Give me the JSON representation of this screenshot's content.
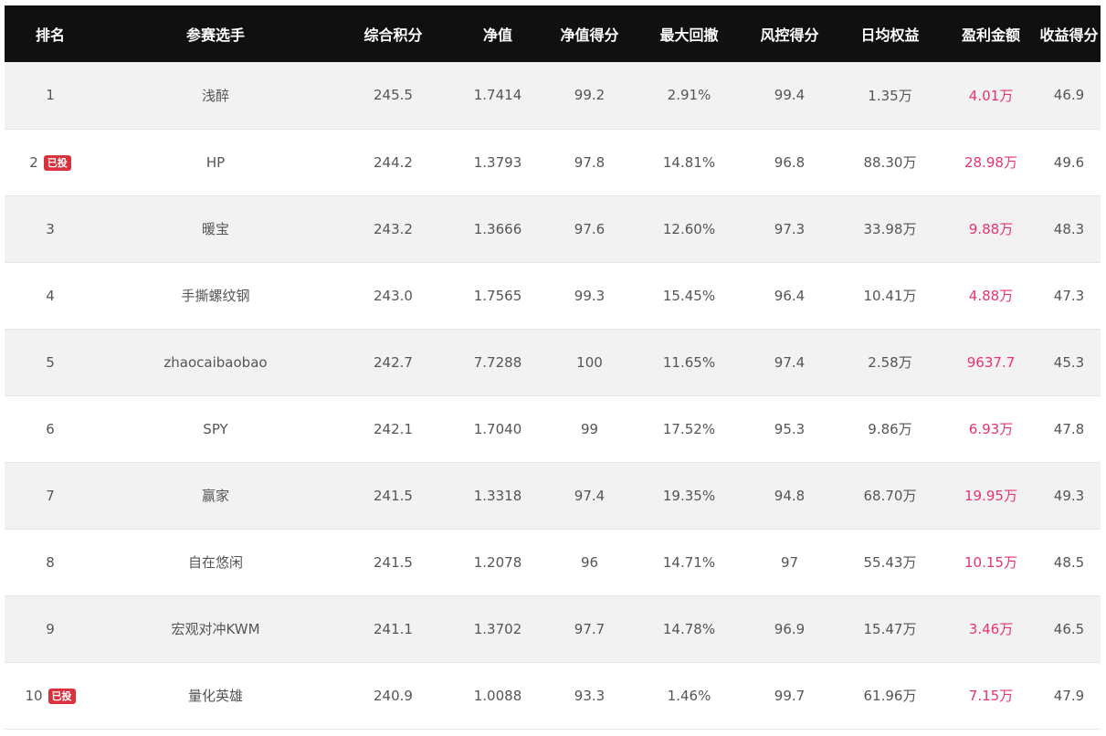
{
  "table": {
    "headers": [
      "排名",
      "参赛选手",
      "综合积分",
      "净值",
      "净值得分",
      "最大回撤",
      "风控得分",
      "日均权益",
      "盈利金额",
      "收益得分"
    ],
    "rows": [
      {
        "rank": "1",
        "badge": "",
        "player": "浅醉",
        "total": "245.5",
        "nav": "1.7414",
        "nav_score": "99.2",
        "max_dd": "2.91%",
        "risk_score": "99.4",
        "avg_equity": "1.35万",
        "profit": "4.01万",
        "return_score": "46.9"
      },
      {
        "rank": "2",
        "badge": "已投",
        "player": "HP",
        "total": "244.2",
        "nav": "1.3793",
        "nav_score": "97.8",
        "max_dd": "14.81%",
        "risk_score": "96.8",
        "avg_equity": "88.30万",
        "profit": "28.98万",
        "return_score": "49.6"
      },
      {
        "rank": "3",
        "badge": "",
        "player": "暖宝",
        "total": "243.2",
        "nav": "1.3666",
        "nav_score": "97.6",
        "max_dd": "12.60%",
        "risk_score": "97.3",
        "avg_equity": "33.98万",
        "profit": "9.88万",
        "return_score": "48.3"
      },
      {
        "rank": "4",
        "badge": "",
        "player": "手撕螺纹钢",
        "total": "243.0",
        "nav": "1.7565",
        "nav_score": "99.3",
        "max_dd": "15.45%",
        "risk_score": "96.4",
        "avg_equity": "10.41万",
        "profit": "4.88万",
        "return_score": "47.3"
      },
      {
        "rank": "5",
        "badge": "",
        "player": "zhaocaibaobao",
        "total": "242.7",
        "nav": "7.7288",
        "nav_score": "100",
        "max_dd": "11.65%",
        "risk_score": "97.4",
        "avg_equity": "2.58万",
        "profit": "9637.7",
        "return_score": "45.3"
      },
      {
        "rank": "6",
        "badge": "",
        "player": "SPY",
        "total": "242.1",
        "nav": "1.7040",
        "nav_score": "99",
        "max_dd": "17.52%",
        "risk_score": "95.3",
        "avg_equity": "9.86万",
        "profit": "6.93万",
        "return_score": "47.8"
      },
      {
        "rank": "7",
        "badge": "",
        "player": "赢家",
        "total": "241.5",
        "nav": "1.3318",
        "nav_score": "97.4",
        "max_dd": "19.35%",
        "risk_score": "94.8",
        "avg_equity": "68.70万",
        "profit": "19.95万",
        "return_score": "49.3"
      },
      {
        "rank": "8",
        "badge": "",
        "player": "自在悠闲",
        "total": "241.5",
        "nav": "1.2078",
        "nav_score": "96",
        "max_dd": "14.71%",
        "risk_score": "97",
        "avg_equity": "55.43万",
        "profit": "10.15万",
        "return_score": "48.5"
      },
      {
        "rank": "9",
        "badge": "",
        "player": "宏观对冲KWM",
        "total": "241.1",
        "nav": "1.3702",
        "nav_score": "97.7",
        "max_dd": "14.78%",
        "risk_score": "96.9",
        "avg_equity": "15.47万",
        "profit": "3.46万",
        "return_score": "46.5"
      },
      {
        "rank": "10",
        "badge": "已投",
        "player": "量化英雄",
        "total": "240.9",
        "nav": "1.0088",
        "nav_score": "93.3",
        "max_dd": "1.46%",
        "risk_score": "99.7",
        "avg_equity": "61.96万",
        "profit": "7.15万",
        "return_score": "47.9"
      }
    ]
  },
  "colors": {
    "header_bg": "#101010",
    "header_text": "#ffffff",
    "row_odd": "#f2f2f2",
    "row_even": "#ffffff",
    "text": "#555555",
    "profit": "#e8336d",
    "badge_bg": "#d9313d"
  }
}
